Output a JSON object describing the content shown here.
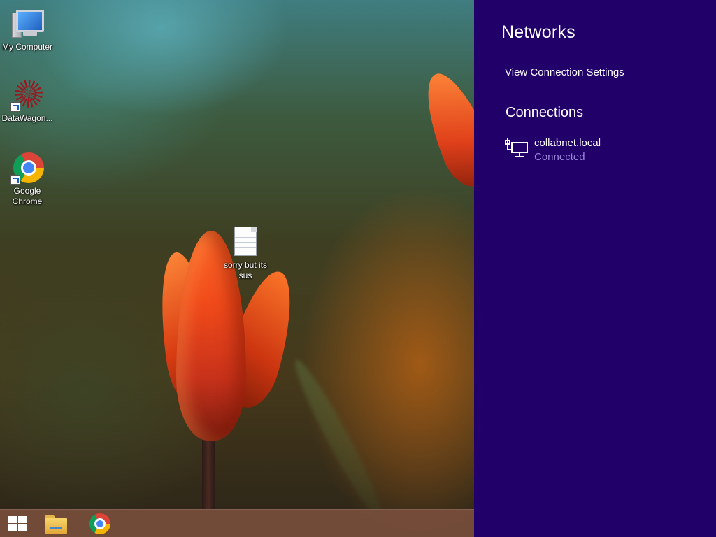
{
  "desktop": {
    "icons": [
      {
        "label": "My Computer",
        "icon": "computer-icon"
      },
      {
        "label": "DataWagon...",
        "icon": "datawagon-icon",
        "shortcut": true
      },
      {
        "label": "Google Chrome",
        "icon": "chrome-icon",
        "shortcut": true
      },
      {
        "label": "sorry but its sus",
        "icon": "text-file-icon"
      }
    ]
  },
  "taskbar": {
    "items": [
      {
        "name": "Start",
        "icon": "windows-logo-icon"
      },
      {
        "name": "File Explorer",
        "icon": "folder-icon"
      },
      {
        "name": "Google Chrome",
        "icon": "chrome-icon"
      }
    ]
  },
  "networks_panel": {
    "title": "Networks",
    "view_settings_link": "View Connection Settings",
    "connections_heading": "Connections",
    "connections": [
      {
        "name": "collabnet.local",
        "status": "Connected",
        "icon": "wired-network-icon"
      }
    ]
  },
  "colors": {
    "panel_background": "#21006a",
    "connection_status": "#9a86d8",
    "taskbar": "#7a4e3c"
  }
}
